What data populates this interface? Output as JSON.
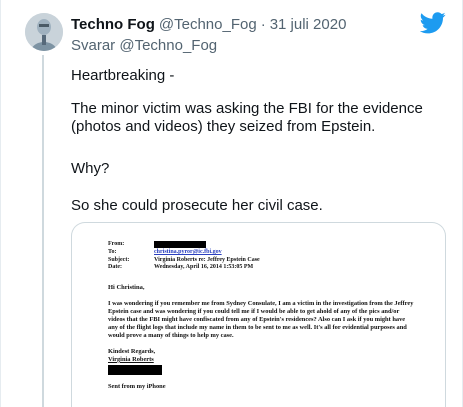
{
  "tweet": {
    "author_name": "Techno Fog",
    "author_handle": "@Techno_Fog",
    "separator": "·",
    "date": "31 juli 2020",
    "reply_prefix": "Svarar",
    "reply_to_handle": "@Techno_Fog",
    "paragraphs": [
      "Heartbreaking -",
      "The minor victim was asking the FBI for the evidence (photos and videos) they seized from Epstein.",
      "Why?",
      "So she could prosecute her civil case."
    ]
  },
  "email": {
    "from_label": "From:",
    "to_label": "To:",
    "to_value": "christina.pyror@ic.fbi.gov",
    "subject_label": "Subject:",
    "subject_value": "Virginia Roberts re: Jeffrey Epstein Case",
    "date_label": "Date:",
    "date_value": "Wednesday, April 16, 2014 1:53:05 PM",
    "greeting": "Hi Christina,",
    "body": "I was wondering if you remember me from Sydney Consulate, I am a victim in the investigation from the Jeffrey Epstein case and was wondering if you could tell me if I would be able to get ahold of any of the pics and/or videos that the FBI might have confiscated from any of Epstein's residences? Also can I ask if you might have any of the flight logs that include my name in them to be sent to me as well. It's all for evidential purposes and would prove a many of things to help my case.",
    "closing": "Kindest Regards,",
    "signature_name": "Virginia Roberts",
    "sent_from": "Sent from my iPhone"
  },
  "colors": {
    "twitter_blue": "#1d9bf0",
    "text_primary": "#0f1419",
    "text_secondary": "#536471",
    "border": "#cfd9de",
    "link": "#2a3fbf"
  },
  "icons": {
    "logo": "twitter-bird-icon"
  }
}
